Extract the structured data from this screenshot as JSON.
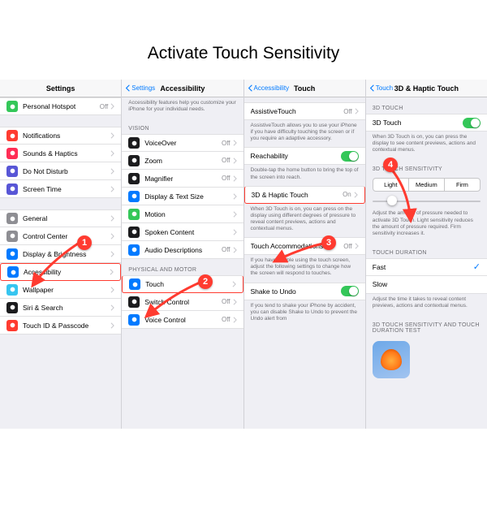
{
  "page_title": "Activate Touch Sensitivity",
  "panel1": {
    "title": "Settings",
    "rows_top": [
      {
        "label": "Personal Hotspot",
        "icon": "link",
        "color": "#34c759",
        "val": "Off"
      }
    ],
    "rows_mid": [
      {
        "label": "Notifications",
        "icon": "bell",
        "color": "#ff3b30"
      },
      {
        "label": "Sounds & Haptics",
        "icon": "sound",
        "color": "#ff2d55"
      },
      {
        "label": "Do Not Disturb",
        "icon": "moon",
        "color": "#5856d6"
      },
      {
        "label": "Screen Time",
        "icon": "hourglass",
        "color": "#5856d6"
      }
    ],
    "rows_bot": [
      {
        "label": "General",
        "icon": "gear",
        "color": "#8e8e93"
      },
      {
        "label": "Control Center",
        "icon": "switches",
        "color": "#8e8e93"
      },
      {
        "label": "Display & Brightness",
        "icon": "text",
        "color": "#007aff"
      },
      {
        "label": "Accessibility",
        "icon": "person",
        "color": "#007aff",
        "hl": true
      },
      {
        "label": "Wallpaper",
        "icon": "flower",
        "color": "#36c5f0"
      },
      {
        "label": "Siri & Search",
        "icon": "siri",
        "color": "#1c1c1e"
      },
      {
        "label": "Touch ID & Passcode",
        "icon": "finger",
        "color": "#ff3b30"
      }
    ]
  },
  "panel2": {
    "back": "Settings",
    "title": "Accessibility",
    "intro": "Accessibility features help you customize your iPhone for your individual needs.",
    "h1": "VISION",
    "vision": [
      {
        "label": "VoiceOver",
        "icon": "voice",
        "color": "#1c1c1e",
        "val": "Off"
      },
      {
        "label": "Zoom",
        "icon": "zoom",
        "color": "#1c1c1e",
        "val": "Off"
      },
      {
        "label": "Magnifier",
        "icon": "mag",
        "color": "#1c1c1e",
        "val": "Off"
      },
      {
        "label": "Display & Text Size",
        "icon": "text",
        "color": "#007aff"
      },
      {
        "label": "Motion",
        "icon": "motion",
        "color": "#34c759"
      },
      {
        "label": "Spoken Content",
        "icon": "speak",
        "color": "#1c1c1e"
      },
      {
        "label": "Audio Descriptions",
        "icon": "audio",
        "color": "#007aff",
        "val": "Off"
      }
    ],
    "h2": "PHYSICAL AND MOTOR",
    "motor": [
      {
        "label": "Touch",
        "icon": "touch",
        "color": "#007aff",
        "hl": true
      },
      {
        "label": "Switch Control",
        "icon": "switch",
        "color": "#1c1c1e",
        "val": "Off"
      },
      {
        "label": "Voice Control",
        "icon": "vc",
        "color": "#007aff",
        "val": "Off"
      }
    ]
  },
  "panel3": {
    "back": "Accessibility",
    "title": "Touch",
    "r1": {
      "label": "AssistiveTouch",
      "val": "Off"
    },
    "f1": "AssistiveTouch allows you to use your iPhone if you have difficulty touching the screen or if you require an adaptive accessory.",
    "r2": {
      "label": "Reachability",
      "on": true
    },
    "f2": "Double-tap the home button to bring the top of the screen into reach.",
    "r3": {
      "label": "3D & Haptic Touch",
      "val": "On",
      "hl": true
    },
    "f3": "When 3D Touch is on, you can press on the display using different degrees of pressure to reveal content previews, actions and contextual menus.",
    "r4": {
      "label": "Touch Accommodations",
      "val": "Off"
    },
    "f4": "If you have trouble using the touch screen, adjust the following settings to change how the screen will respond to touches.",
    "r5": {
      "label": "Shake to Undo",
      "on": true
    },
    "f5": "If you tend to shake your iPhone by accident, you can disable Shake to Undo to prevent the Undo alert from"
  },
  "panel4": {
    "back": "Touch",
    "title": "3D & Haptic Touch",
    "h1": "3D TOUCH",
    "r1": {
      "label": "3D Touch",
      "on": true
    },
    "f1": "When 3D Touch is on, you can press the display to see content previews, actions and contextual menus.",
    "h2": "3D TOUCH SENSITIVITY",
    "seg": [
      "Light",
      "Medium",
      "Firm"
    ],
    "f2": "Adjust the amount of pressure needed to activate 3D Touch. Light sensitivity reduces the amount of pressure required. Firm sensitivity increases it.",
    "h3": "TOUCH DURATION",
    "dur": [
      {
        "label": "Fast",
        "check": true
      },
      {
        "label": "Slow"
      }
    ],
    "f3": "Adjust the time it takes to reveal content previews, actions and contextual menus.",
    "h4": "3D TOUCH SENSITIVITY AND TOUCH DURATION TEST"
  },
  "badges": [
    "1",
    "2",
    "3",
    "4"
  ]
}
